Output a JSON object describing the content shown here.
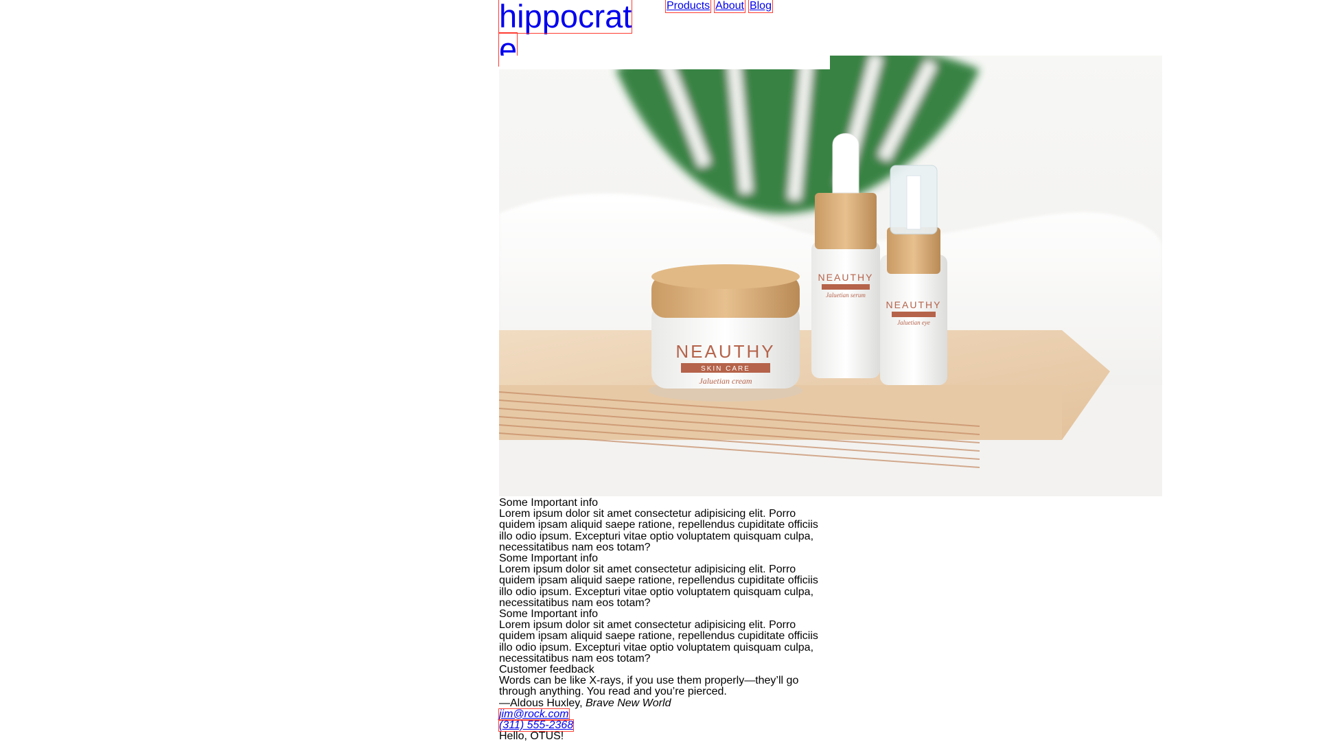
{
  "brand": {
    "logo_line1": "hippocrat",
    "logo_line2": "e"
  },
  "nav": {
    "items": [
      "Products",
      "About",
      "Blog"
    ]
  },
  "hero": {
    "image_alt": "Skincare product photo: cream jar and two dropper/pump bottles on a wooden board with towel and monstera leaf",
    "brand_on_products": "NEAUTHY",
    "subbrand_on_products": "SKIN CARE",
    "labels": [
      "Jaluetian cream",
      "Jaluetian serum",
      "Jaluetian eye"
    ]
  },
  "sections": [
    {
      "heading": "Some Important info",
      "body": "Lorem ipsum dolor sit amet consectetur adipisicing elit. Porro quidem ipsam aliquid saepe ratione, repellendus cupiditate officiis illo odio ipsum. Excepturi vitae optio voluptatem quisquam culpa, necessitatibus nam eos totam?"
    },
    {
      "heading": "Some Important info",
      "body": "Lorem ipsum dolor sit amet consectetur adipisicing elit. Porro quidem ipsam aliquid saepe ratione, repellendus cupiditate officiis illo odio ipsum. Excepturi vitae optio voluptatem quisquam culpa, necessitatibus nam eos totam?"
    },
    {
      "heading": "Some Important info",
      "body": "Lorem ipsum dolor sit amet consectetur adipisicing elit. Porro quidem ipsam aliquid saepe ratione, repellendus cupiditate officiis illo odio ipsum. Excepturi vitae optio voluptatem quisquam culpa, necessitatibus nam eos totam?"
    }
  ],
  "feedback": {
    "heading": "Customer feedback",
    "quote": "Words can be like X-rays, if you use them properly—they’ll go through anything. You read and you’re pierced.",
    "attribution_prefix": "—Aldous Huxley, ",
    "attribution_title": "Brave New World"
  },
  "contact": {
    "email": "jim@rock.com",
    "phone": "(311) 555-2368"
  },
  "footer": {
    "text": "Hello, OTUS!"
  },
  "colors": {
    "link": "#0000ee",
    "outline": "#ff3b30",
    "label_band": "#b5634a",
    "wood": "#e8c9a4",
    "leaf": "#2f7d3a"
  }
}
